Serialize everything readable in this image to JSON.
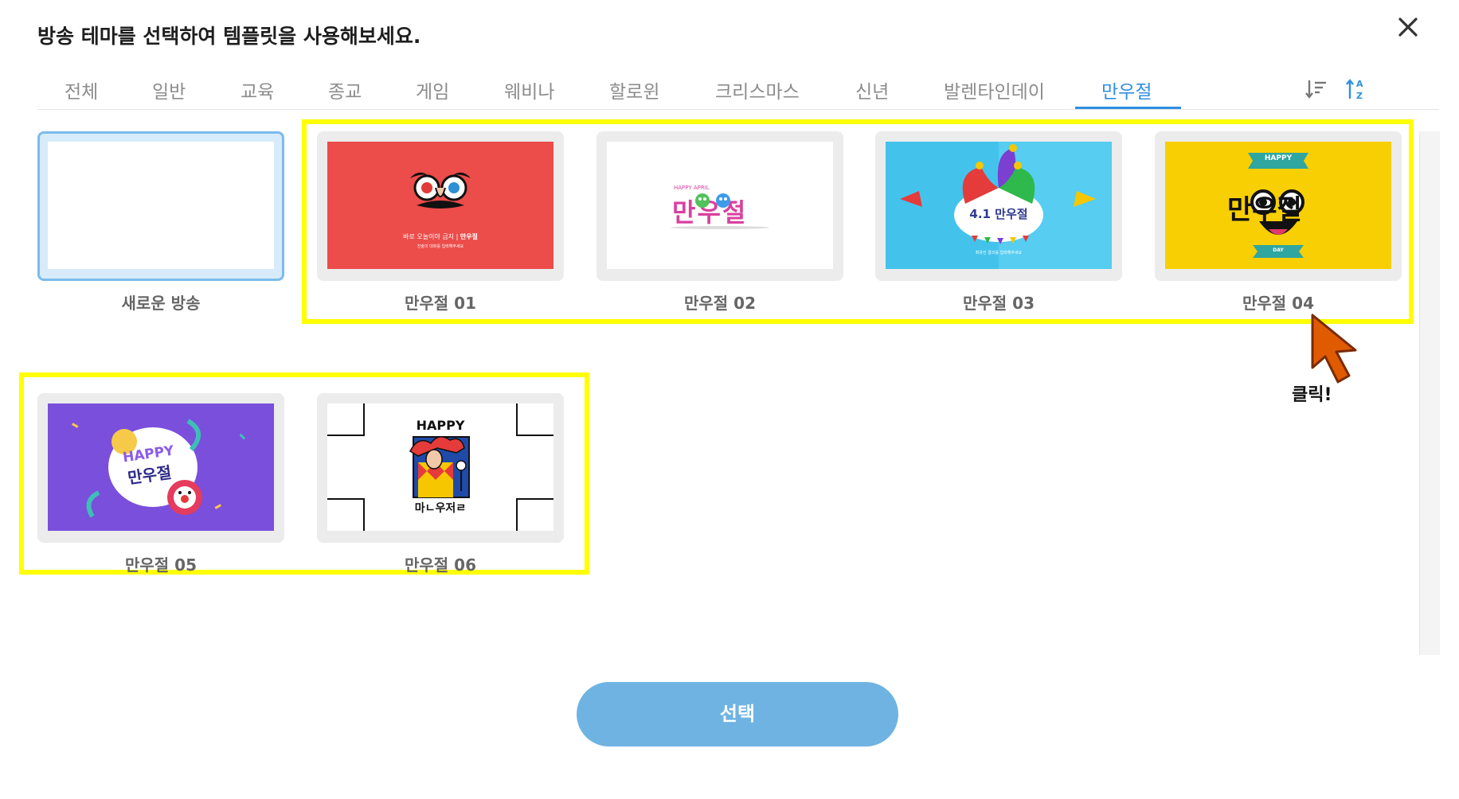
{
  "dialog": {
    "title": "방송 테마를 선택하여 템플릿을 사용해보세요.",
    "close_icon": "close-icon"
  },
  "tabs": [
    {
      "label": "전체"
    },
    {
      "label": "일반"
    },
    {
      "label": "교육"
    },
    {
      "label": "종교"
    },
    {
      "label": "게임"
    },
    {
      "label": "웨비나"
    },
    {
      "label": "할로윈"
    },
    {
      "label": "크리스마스"
    },
    {
      "label": "신년"
    },
    {
      "label": "발렌타인데이"
    },
    {
      "label": "만우절",
      "active": true
    }
  ],
  "sort": {
    "sort_desc_icon": "sort-descending-icon",
    "sort_az_icon": "sort-alphabetical-icon"
  },
  "cards": [
    {
      "label": "새로운 방송",
      "selected": true
    },
    {
      "label": "만우절 01",
      "thumb": {
        "line1a": "바로 오늘이야 금지",
        "line1b": "만우절",
        "line2": "진술의 대화를 입력해주세요"
      }
    },
    {
      "label": "만우절 02",
      "thumb": {
        "small": "HAPPY APRIL",
        "big": "만우절"
      }
    },
    {
      "label": "만우절 03",
      "thumb": {
        "big": "4.1 만우절",
        "small": "최유진 결과를 입력해주세요"
      }
    },
    {
      "label": "만우절 04",
      "thumb": {
        "top": "HAPPY",
        "big": "만우절",
        "bottom": "DAY"
      }
    },
    {
      "label": "만우절 05",
      "thumb": {
        "top": "HAPPY",
        "big": "만우절"
      }
    },
    {
      "label": "만우절 06",
      "thumb": {
        "top": "HAPPY",
        "bottom": "마ㄴ우저ㄹ"
      }
    }
  ],
  "annotation": {
    "click_label": "클릭!"
  },
  "footer": {
    "select_label": "선택"
  },
  "colors": {
    "accent": "#2f8fe0",
    "select_button": "#6fb3e3",
    "highlight": "#ffff00",
    "pointer": "#e05a00"
  }
}
